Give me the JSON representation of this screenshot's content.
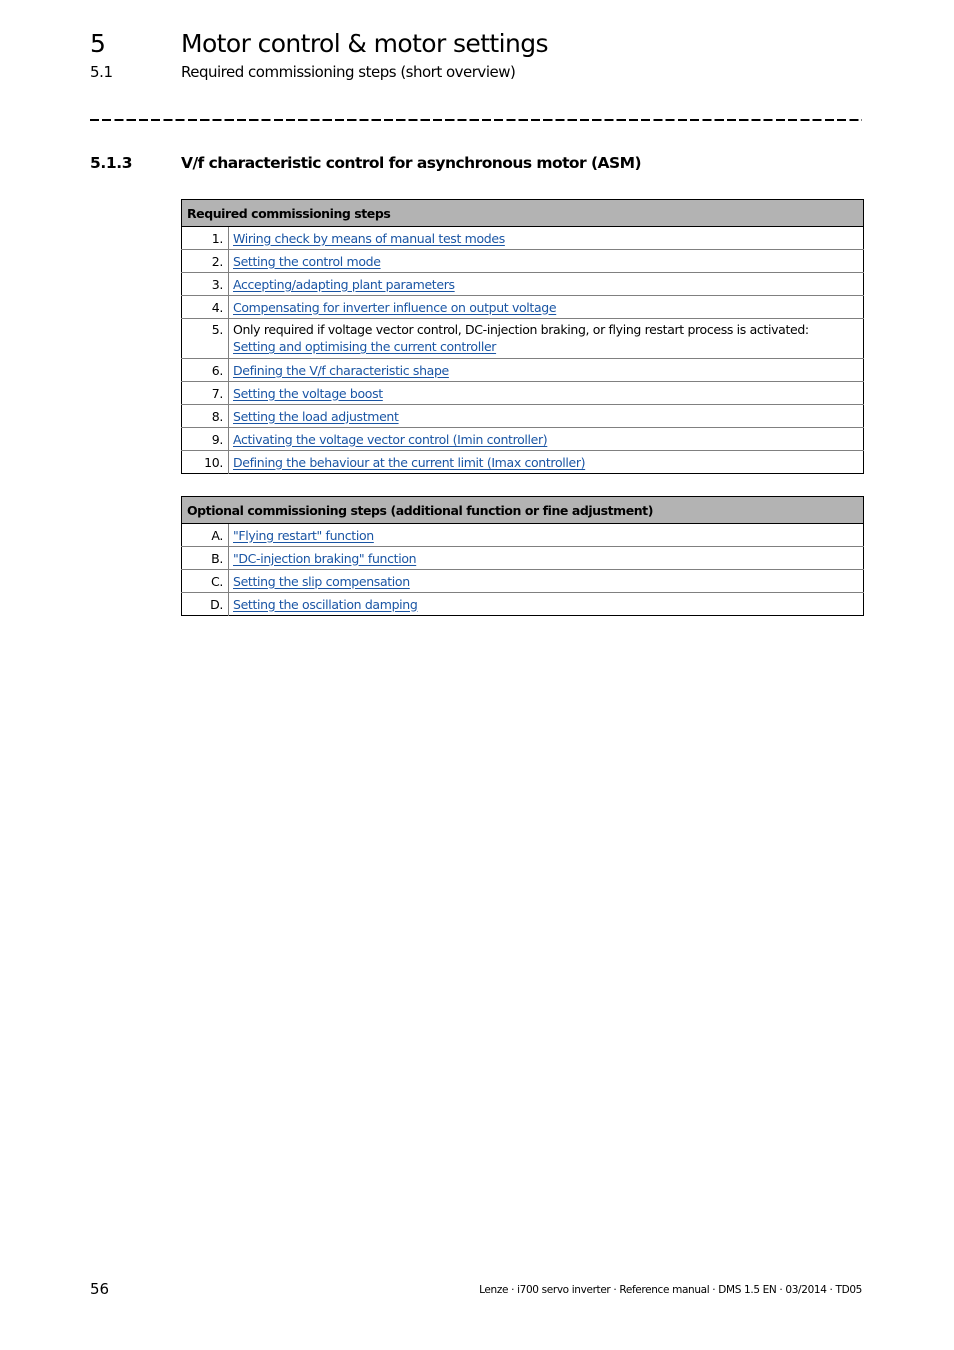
{
  "header": {
    "chapter_number": "5",
    "chapter_title": "Motor control & motor settings",
    "section_number": "5.1",
    "section_title": "Required commissioning steps (short overview)"
  },
  "subsection": {
    "number": "5.1.3",
    "title": "V/f characteristic control for asynchronous motor (ASM)"
  },
  "required_table": {
    "heading": "Required commissioning steps",
    "rows": [
      {
        "index": "1.",
        "link": "Wiring check by means of manual test modes"
      },
      {
        "index": "2.",
        "link": "Setting the control mode"
      },
      {
        "index": "3.",
        "link": "Accepting/adapting plant parameters"
      },
      {
        "index": "4.",
        "link": "Compensating for inverter influence on output voltage"
      },
      {
        "index": "5.",
        "text": "Only required if voltage vector control, DC-injection braking, or flying restart process is activated:",
        "link": "Setting and optimising the current controller"
      },
      {
        "index": "6.",
        "link": "Defining the V/f characteristic shape"
      },
      {
        "index": "7.",
        "link": "Setting the voltage boost"
      },
      {
        "index": "8.",
        "link": "Setting the load adjustment"
      },
      {
        "index": "9.",
        "link": "Activating the voltage vector control (Imin controller)"
      },
      {
        "index": "10.",
        "link": "Defining the behaviour at the current limit (Imax controller)"
      }
    ]
  },
  "optional_table": {
    "heading": "Optional commissioning steps (additional function or fine adjustment)",
    "rows": [
      {
        "index": "A.",
        "link": "\"Flying restart\" function"
      },
      {
        "index": "B.",
        "link": "\"DC-injection braking\" function"
      },
      {
        "index": "C.",
        "link": "Setting the slip compensation"
      },
      {
        "index": "D.",
        "link": "Setting the oscillation damping"
      }
    ]
  },
  "footer": {
    "page_number": "56",
    "document_info": "Lenze · i700 servo inverter · Reference manual · DMS 1.5 EN · 03/2014 · TD05"
  },
  "colors": {
    "link": "#1a55a4",
    "table_header_bg": "#b3b3b3",
    "row_divider": "#808080"
  }
}
